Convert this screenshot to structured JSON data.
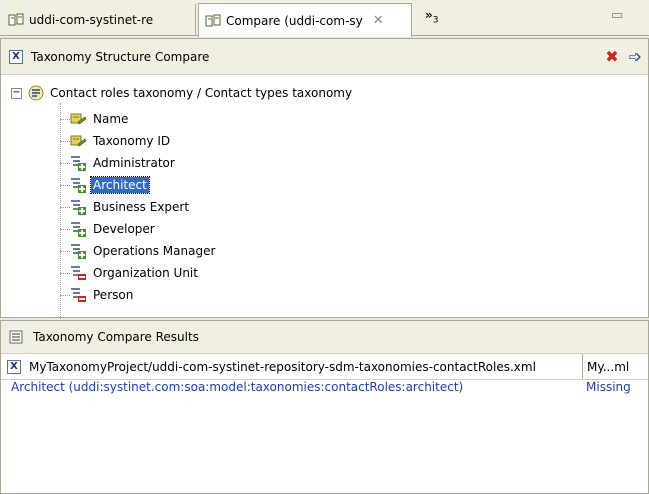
{
  "tabs": [
    {
      "label": "uddi-com-systinet-re",
      "active": false
    },
    {
      "label": "Compare (uddi-com-sy",
      "active": true
    }
  ],
  "tab_overflow": {
    "symbol": "»",
    "count": "3"
  },
  "structure_panel": {
    "title": "Taxonomy Structure Compare",
    "root": {
      "label": "Contact roles taxonomy / Contact types taxonomy",
      "expander": "−"
    },
    "nodes": [
      {
        "label": "Name",
        "icon": "property-icon"
      },
      {
        "label": "Taxonomy ID",
        "icon": "property-icon"
      },
      {
        "label": "Administrator",
        "icon": "category-added-icon"
      },
      {
        "label": "Architect",
        "icon": "category-added-icon",
        "selected": true
      },
      {
        "label": "Business Expert",
        "icon": "category-added-icon"
      },
      {
        "label": "Developer",
        "icon": "category-added-icon"
      },
      {
        "label": "Operations Manager",
        "icon": "category-added-icon"
      },
      {
        "label": "Organization Unit",
        "icon": "category-removed-icon"
      },
      {
        "label": "Person",
        "icon": "category-removed-icon"
      }
    ]
  },
  "results_panel": {
    "title": "Taxonomy Compare Results",
    "columns": [
      "MyTaxonomyProject/uddi-com-systinet-repository-sdm-taxonomies-contactRoles.xml",
      "My...ml"
    ],
    "rows": [
      {
        "item": "Architect (uddi:systinet.com:soa:model:taxonomies:contactRoles:architect)",
        "status": "Missing"
      }
    ]
  },
  "colors": {
    "selection": "#316AC5",
    "result_text": "#1B3CC0",
    "remove_red": "#D62020"
  }
}
